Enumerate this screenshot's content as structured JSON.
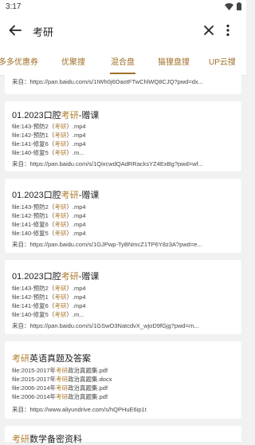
{
  "status": {
    "time": "3:17"
  },
  "search": {
    "query": "考研"
  },
  "tabs": [
    {
      "label": "多多优惠券"
    },
    {
      "label": "优聚搜"
    },
    {
      "label": "混合盘"
    },
    {
      "label": "猫狸盘搜"
    },
    {
      "label": "UP云搜"
    }
  ],
  "top_source": {
    "prefix": "来自：",
    "url": "https://pan.baidu.com/s/1IWh0j6OaotFTwChlWQ8CJQ?pwd=dx..."
  },
  "results": [
    {
      "title_pre": "01.2023口腔",
      "title_hl": "考研",
      "title_post": "-赠课",
      "files": [
        {
          "pre": "file:143-预防2（",
          "hl": "考研",
          "post": "）.mp4"
        },
        {
          "pre": "file:142-预防1（",
          "hl": "考研",
          "post": "）.mp4"
        },
        {
          "pre": "file:141-修复6（",
          "hl": "考研",
          "post": "）.mp4"
        },
        {
          "pre": "file:140-修复5（",
          "hl": "考研",
          "post": "）.m..."
        }
      ],
      "source_prefix": "来自：",
      "source_url": "https://pan.baidu.com/s/1QixcwdQAdRRacksYZ4ExBg?pwd=wf..."
    },
    {
      "title_pre": "01.2023口腔",
      "title_hl": "考研",
      "title_post": "-赠课",
      "files": [
        {
          "pre": "file:143-预防2（",
          "hl": "考研",
          "post": "）.mp4"
        },
        {
          "pre": "file:142-预防1（",
          "hl": "考研",
          "post": "）.mp4"
        },
        {
          "pre": "file:141-修复6（",
          "hl": "考研",
          "post": "）.mp4"
        },
        {
          "pre": "file:140-修复5（",
          "hl": "考研",
          "post": "）.mp4"
        }
      ],
      "source_prefix": "来自：",
      "source_url": "https://pan.baidu.com/s/1GJPwp-TyBNmcZ1TP6Y8z3A?pwd=e..."
    },
    {
      "title_pre": "01.2023口腔",
      "title_hl": "考研",
      "title_post": "-赠课",
      "files": [
        {
          "pre": "file:143-预防2（",
          "hl": "考研",
          "post": "）.mp4"
        },
        {
          "pre": "file:142-预防1（",
          "hl": "考研",
          "post": "）.mp4"
        },
        {
          "pre": "file:141-修复6（",
          "hl": "考研",
          "post": "）.mp4"
        },
        {
          "pre": "file:140-修复5（",
          "hl": "考研",
          "post": "）.m..."
        }
      ],
      "source_prefix": "来自：",
      "source_url": "https://pan.baidu.com/s/1GSwO3NatcdvX_wjoD9fGjg?pwd=rn..."
    },
    {
      "title_pre": "",
      "title_hl": "考研",
      "title_post": "英语真题及答案",
      "files": [
        {
          "pre": "file:2015-2017年",
          "hl": "考研",
          "post": "政治真题集.pdf"
        },
        {
          "pre": "file:2015-2017年",
          "hl": "考研",
          "post": "政治真题集.docx"
        },
        {
          "pre": "file:2006-2014年",
          "hl": "考研",
          "post": "政治真题集.pdf"
        },
        {
          "pre": "file:2006-2014年",
          "hl": "考研",
          "post": "政治真题集.pdf"
        }
      ],
      "source_prefix": "来自：",
      "source_url": "https://www.aliyundrive.com/s/hQPHuE6ip1t"
    },
    {
      "title_pre": "",
      "title_hl": "考研",
      "title_post": "数学备密资料",
      "files": [],
      "source_prefix": "",
      "source_url": ""
    }
  ],
  "colors": {
    "accent": "#a07028",
    "highlight": "#b07d2e",
    "background": "#f1f1f1"
  }
}
